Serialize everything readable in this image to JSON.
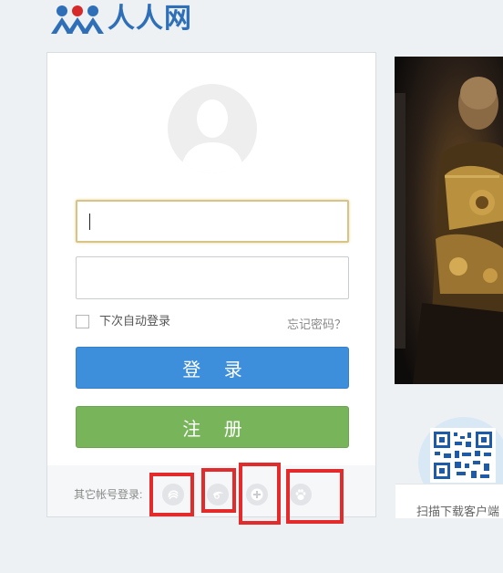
{
  "logo": {
    "text": "人人网"
  },
  "login_form": {
    "username_value": "",
    "password_value": "",
    "remember_label": "下次自动登录",
    "forgot_label": "忘记密码？",
    "login_button": "登 录",
    "register_button": "注 册",
    "other_login_label": "其它帐号登录:",
    "other_login_providers": [
      {
        "name": "china-mobile",
        "icon": "china-mobile-icon"
      },
      {
        "name": "tianyi",
        "icon": "tianyi-icon"
      },
      {
        "name": "add-account",
        "icon": "plus-icon"
      },
      {
        "name": "baidu",
        "icon": "paw-icon"
      }
    ]
  },
  "download": {
    "caption": "扫描下载客户端"
  },
  "colors": {
    "brand_blue": "#2e6fb8",
    "login_button": "#3e8fdb",
    "register_button": "#78b45a",
    "highlight_red": "#e32b2b"
  }
}
